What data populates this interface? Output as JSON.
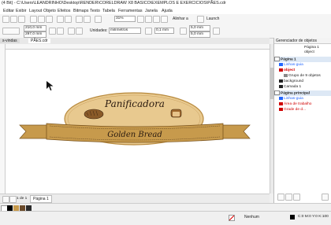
{
  "window": {
    "title": "(4 Bit) - C:\\Users\\LEANDRINHO\\Desktop\\RENDER\\CORELDRAW X8 BASICO\\EXEMPLOS E EXERCICIOS\\PÃES.cdr"
  },
  "menu": [
    "Editar",
    "Exibir",
    "Layout",
    "Objeto",
    "Efeitos",
    "Bitmaps",
    "Texto",
    "Tabela",
    "Ferramentas",
    "Janela",
    "Ajuda"
  ],
  "toolbar": {
    "zoom": "31%",
    "align_label": "Alinhar a",
    "launch_label": "Launch"
  },
  "propbar": {
    "width": "210,0 mm",
    "height": "297,0 mm",
    "units_label": "Unidades:",
    "units_value": "milímetros",
    "nudge": "0,1 mm",
    "dup_x": "5,0 mm",
    "dup_y": "5,0 mm"
  },
  "doc_tabs": [
    "s-vindas",
    "PÃES.cdr"
  ],
  "artwork": {
    "title": "Panificadora",
    "banner": "Golden Bread",
    "colors": {
      "oval": "#e8c98f",
      "banner": "#c79a4c",
      "banner_dark": "#9a6f2a",
      "text": "#2b1b10"
    }
  },
  "object_manager": {
    "title": "Gerenciador de objetos",
    "header_page": "Página 1",
    "header_sub": "object",
    "rows": [
      {
        "label": "Página 1",
        "bold": true
      },
      {
        "label": "Linhas-guia",
        "color": "#2266ff"
      },
      {
        "label": "object",
        "color": "#d00000",
        "bold": true
      },
      {
        "label": "Grupo de 9 objetos"
      },
      {
        "label": "background"
      },
      {
        "label": "Camada 1"
      },
      {
        "label": "Página principal",
        "bold": true
      },
      {
        "label": "Linhas-guia",
        "color": "#2266ff"
      },
      {
        "label": "Área de trabalho",
        "color": "#d00000"
      },
      {
        "label": "Grade de d...",
        "color": "#d00000"
      }
    ]
  },
  "pagebar": {
    "page_label": "Página 1",
    "page_count": "1 de 1"
  },
  "status": {
    "fill": "Nenhum",
    "cmyk": "C:0 M:0 Y:0 K:100"
  }
}
